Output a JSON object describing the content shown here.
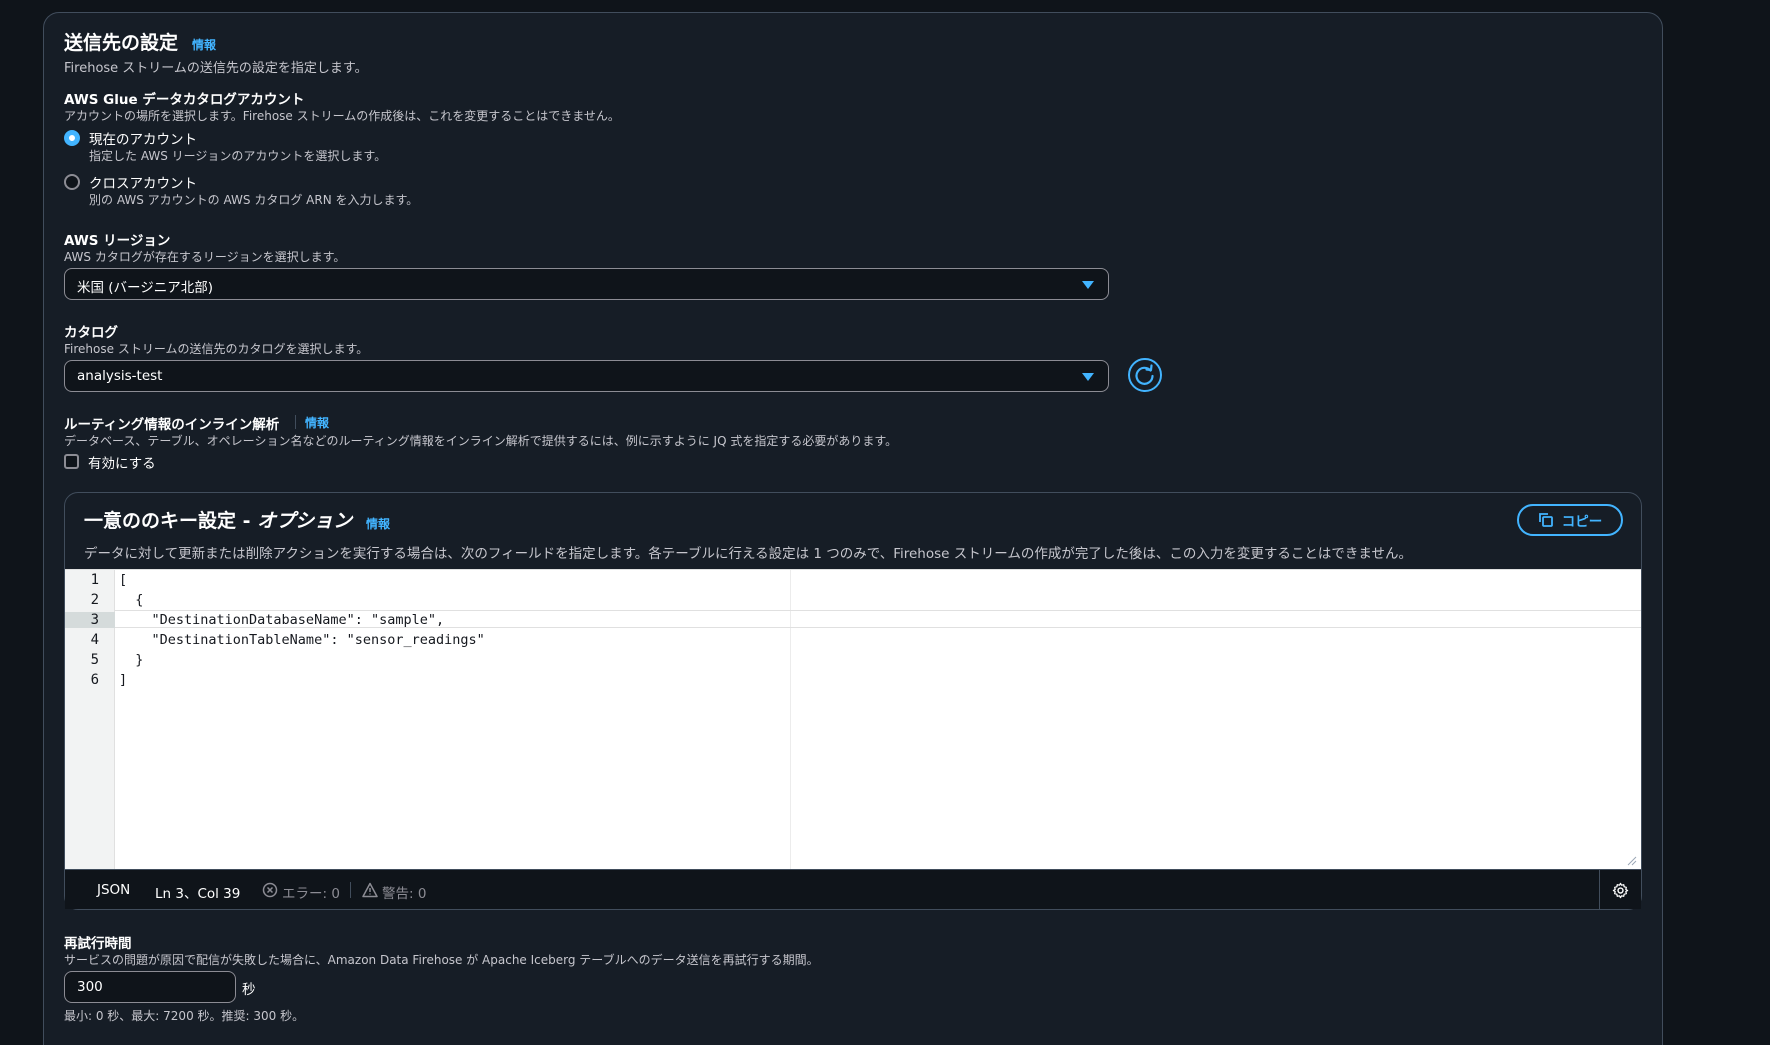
{
  "section": {
    "title": "送信先の設定",
    "info": "情報",
    "description": "Firehose ストリームの送信先の設定を指定します。"
  },
  "glue_account": {
    "label": "AWS Glue データカタログアカウント",
    "description": "アカウントの場所を選択します。Firehose ストリームの作成後は、これを変更することはできません。",
    "options": [
      {
        "label": "現在のアカウント",
        "description": "指定した AWS リージョンのアカウントを選択します。",
        "selected": true
      },
      {
        "label": "クロスアカウント",
        "description": "別の AWS アカウントの AWS カタログ ARN を入力します。",
        "selected": false
      }
    ]
  },
  "region": {
    "label": "AWS リージョン",
    "description": "AWS カタログが存在するリージョンを選択します。",
    "value": "米国 (バージニア北部)"
  },
  "catalog": {
    "label": "カタログ",
    "description": "Firehose ストリームの送信先のカタログを選択します。",
    "value": "analysis-test"
  },
  "routing": {
    "label": "ルーティング情報のインライン解析",
    "info": "情報",
    "description": "データベース、テーブル、オペレーション名などのルーティング情報をインライン解析で提供するには、例に示すように JQ 式を指定する必要があります。",
    "checkbox_label": "有効にする",
    "checked": false
  },
  "unique_keys": {
    "title_main": "一意ののキー設定 - ",
    "title_italic": "オプション",
    "info": "情報",
    "description": "データに対して更新または削除アクションを実行する場合は、次のフィールドを指定します。各テーブルに行える設定は 1 つのみで、Firehose ストリームの作成が完了した後は、この入力を変更することはできません。",
    "copy_label": "コピー",
    "code_lines": [
      "[",
      "  {",
      "    \"DestinationDatabaseName\": \"sample\",",
      "    \"DestinationTableName\": \"sensor_readings\"",
      "  }",
      "]"
    ],
    "line_numbers": [
      "1",
      "2",
      "3",
      "4",
      "5",
      "6"
    ],
    "active_line": 3,
    "status": {
      "language": "JSON",
      "position": "Ln 3、Col 39",
      "errors": "エラー: 0",
      "warnings": "警告: 0"
    }
  },
  "retry": {
    "label": "再試行時間",
    "description": "サービスの問題が原因で配信が失敗した場合に、Amazon Data Firehose が Apache Iceberg テーブルへのデータ送信を再試行する期間。",
    "value": "300",
    "unit": "秒",
    "constraint": "最小: 0 秒、最大: 7200 秒。推奨: 300 秒。"
  },
  "colors": {
    "accent": "#42b4ff",
    "background": "#0f141a",
    "panel": "#161d26",
    "border": "#414d5c"
  }
}
